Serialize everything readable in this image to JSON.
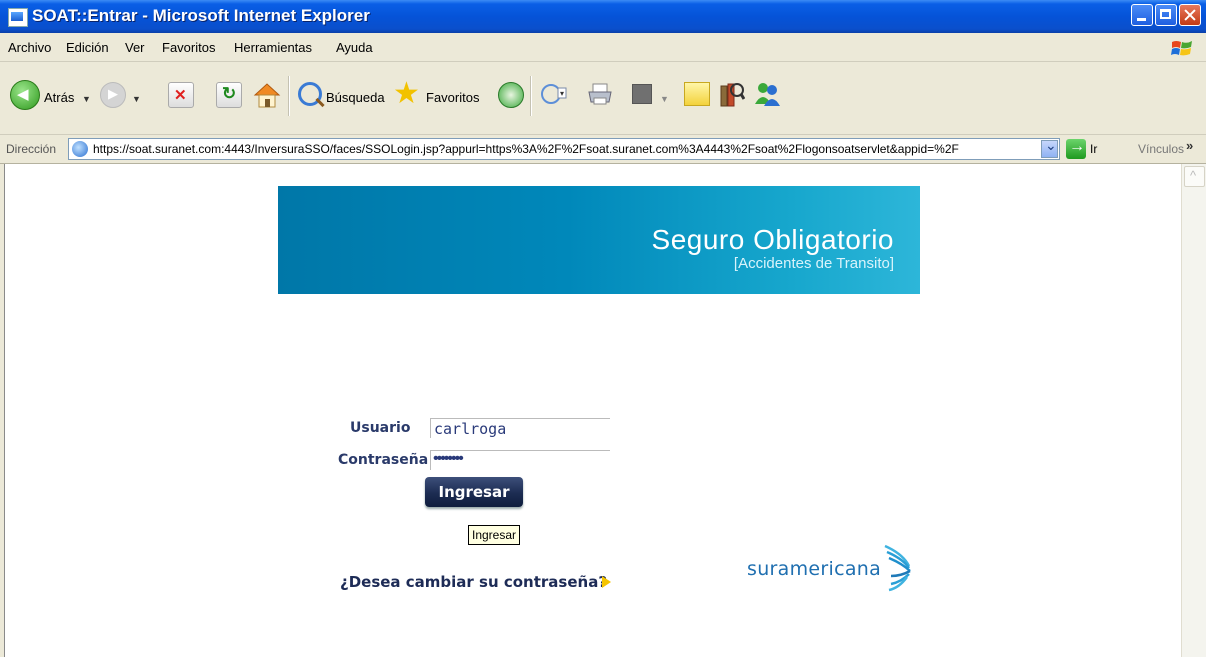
{
  "window": {
    "title": "SOAT::Entrar - Microsoft Internet Explorer"
  },
  "menu": [
    "Archivo",
    "Edición",
    "Ver",
    "Favoritos",
    "Herramientas",
    "Ayuda"
  ],
  "toolbar": {
    "back_label": "Atrás",
    "search_label": "Búsqueda",
    "favorites_label": "Favoritos"
  },
  "address": {
    "label": "Dirección",
    "url": "https://soat.suranet.com:4443/InversuraSSO/faces/SSOLogin.jsp?appurl=https%3A%2F%2Fsoat.suranet.com%3A4443%2Fsoat%2Flogonsoatservlet&appid=%2F",
    "go_label": "Ir",
    "links_label": "Vínculos"
  },
  "banner": {
    "title": "Seguro Obligatorio",
    "subtitle": "[Accidentes de Transito]"
  },
  "form": {
    "user_label": "Usuario",
    "user_value": "carlroga",
    "password_label": "Contraseña",
    "password_mask": "••••••••",
    "submit_label": "Ingresar",
    "tooltip": "Ingresar"
  },
  "change_password_link": "¿Desea cambiar su contraseña?",
  "brand": {
    "name": "suramericana",
    "color": "#1f6fb0"
  },
  "colors": {
    "titlebar": "#0553d8",
    "banner": "#0088ba",
    "label": "#2a3a6a"
  }
}
